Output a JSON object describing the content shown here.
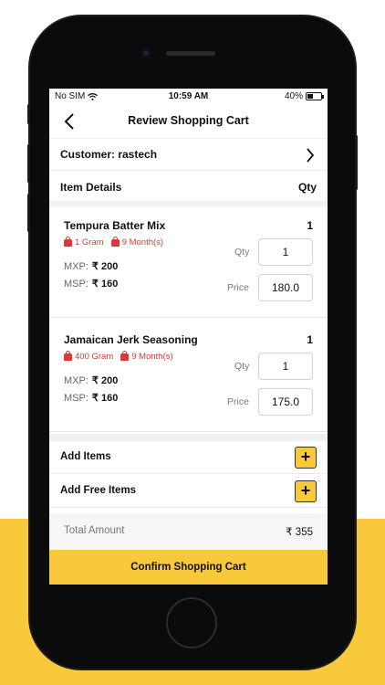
{
  "status_bar": {
    "carrier": "No SIM",
    "time": "10:59 AM",
    "battery": "40%",
    "battery_level": 0.4
  },
  "nav": {
    "title": "Review Shopping Cart",
    "back_icon": "chevron-left-icon"
  },
  "customer": {
    "label": "Customer: rastech",
    "icon": "chevron-right-icon"
  },
  "items_header": {
    "left": "Item Details",
    "right": "Qty"
  },
  "items": [
    {
      "name": "Tempura Batter Mix",
      "count": "1",
      "weight": "1 Gram",
      "shelf_life": "9 Month(s)",
      "mxp_label": "MXP:",
      "mxp_value": "₹ 200",
      "msp_label": "MSP:",
      "msp_value": "₹ 160",
      "qty_label": "Qty",
      "qty_value": "1",
      "price_label": "Price",
      "price_value": "180.0"
    },
    {
      "name": "Jamaican Jerk Seasoning",
      "count": "1",
      "weight": "400 Gram",
      "shelf_life": "9 Month(s)",
      "mxp_label": "MXP:",
      "mxp_value": "₹ 200",
      "msp_label": "MSP:",
      "msp_value": "₹ 160",
      "qty_label": "Qty",
      "qty_value": "1",
      "price_label": "Price",
      "price_value": "175.0"
    }
  ],
  "actions": {
    "add_items": "Add Items",
    "add_free_items": "Add Free Items",
    "plus_symbol": "+"
  },
  "total": {
    "label": "Total Amount",
    "value": "₹ 355"
  },
  "confirm": {
    "label": "Confirm Shopping Cart"
  },
  "colors": {
    "accent": "#f8c93a",
    "tag_red": "#d63a3a"
  }
}
